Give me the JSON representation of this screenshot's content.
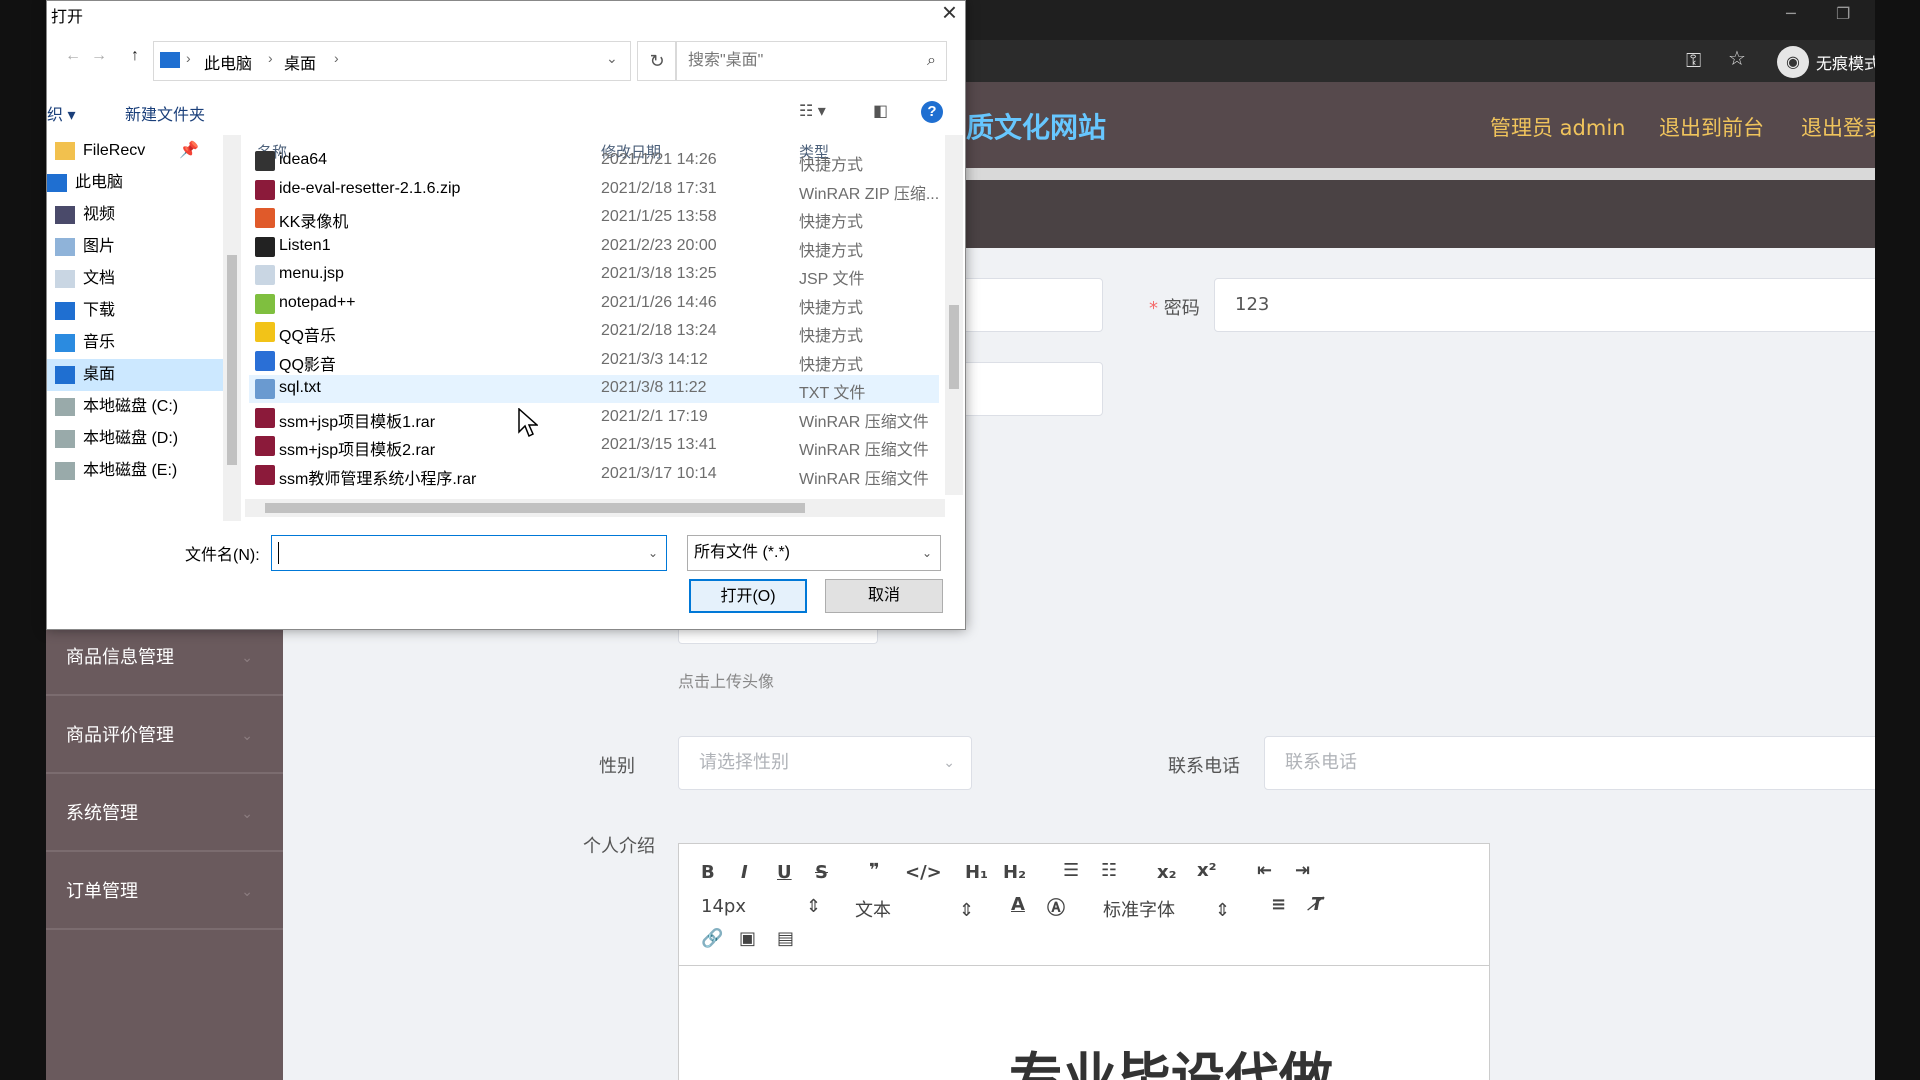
{
  "browser": {
    "profile_label": "无痕模式",
    "app": {
      "site_title": "质文化网站",
      "header_links": [
        "管理员 admin",
        "退出到前台",
        "退出登录"
      ]
    },
    "sidebar": {
      "items": [
        "商品信息管理",
        "商品评价管理",
        "系统管理",
        "订单管理"
      ]
    },
    "form": {
      "password_label": "密码",
      "password_value": "123",
      "upload_hint": "点击上传头像",
      "gender_label": "性别",
      "gender_placeholder": "请选择性别",
      "phone_label": "联系电话",
      "phone_placeholder": "联系电话",
      "intro_label": "个人介绍",
      "editor": {
        "font_size": "14px",
        "text_type": "文本",
        "font_family": "标准字体",
        "content_preview": "专业毕设代做"
      }
    }
  },
  "dialog": {
    "title": "打开",
    "address": [
      "此电脑",
      "桌面"
    ],
    "search_placeholder": "搜索\"桌面\"",
    "organize": "织",
    "new_folder": "新建文件夹",
    "nav": [
      {
        "label": "FileRecv",
        "icon": "folder-icon"
      },
      {
        "label": "此电脑",
        "icon": "computer-icon"
      },
      {
        "label": "视频",
        "icon": "video-icon"
      },
      {
        "label": "图片",
        "icon": "picture-icon"
      },
      {
        "label": "文档",
        "icon": "document-icon"
      },
      {
        "label": "下载",
        "icon": "download-icon"
      },
      {
        "label": "音乐",
        "icon": "music-icon"
      },
      {
        "label": "桌面",
        "icon": "desktop-icon",
        "selected": true
      },
      {
        "label": "本地磁盘 (C:)",
        "icon": "drive-icon"
      },
      {
        "label": "本地磁盘 (D:)",
        "icon": "drive-icon"
      },
      {
        "label": "本地磁盘 (E:)",
        "icon": "drive-icon"
      }
    ],
    "columns": [
      "名称",
      "修改日期",
      "类型"
    ],
    "files": [
      {
        "name": "idea64",
        "date": "2021/1/21 14:26",
        "type": "快捷方式",
        "icon": "app-shortcut-icon",
        "color": "#333333"
      },
      {
        "name": "ide-eval-resetter-2.1.6.zip",
        "date": "2021/2/18 17:31",
        "type": "WinRAR ZIP 压缩...",
        "icon": "winrar-icon",
        "color": "#8b1a3a"
      },
      {
        "name": "KK录像机",
        "date": "2021/1/25 13:58",
        "type": "快捷方式",
        "icon": "app-shortcut-icon",
        "color": "#e05a2a"
      },
      {
        "name": "Listen1",
        "date": "2021/2/23 20:00",
        "type": "快捷方式",
        "icon": "app-shortcut-icon",
        "color": "#222222"
      },
      {
        "name": "menu.jsp",
        "date": "2021/3/18 13:25",
        "type": "JSP 文件",
        "icon": "file-icon",
        "color": "#c9d6e3"
      },
      {
        "name": "notepad++",
        "date": "2021/1/26 14:46",
        "type": "快捷方式",
        "icon": "app-shortcut-icon",
        "color": "#7fbf3f"
      },
      {
        "name": "QQ音乐",
        "date": "2021/2/18 13:24",
        "type": "快捷方式",
        "icon": "app-shortcut-icon",
        "color": "#f2c318"
      },
      {
        "name": "QQ影音",
        "date": "2021/3/3 14:12",
        "type": "快捷方式",
        "icon": "app-shortcut-icon",
        "color": "#2a6fd6"
      },
      {
        "name": "sql.txt",
        "date": "2021/3/8 11:22",
        "type": "TXT 文件",
        "icon": "text-file-icon",
        "color": "#6a9ad0",
        "hover": true
      },
      {
        "name": "ssm+jsp项目模板1.rar",
        "date": "2021/2/1 17:19",
        "type": "WinRAR 压缩文件",
        "icon": "winrar-icon",
        "color": "#8b1a3a"
      },
      {
        "name": "ssm+jsp项目模板2.rar",
        "date": "2021/3/15 13:41",
        "type": "WinRAR 压缩文件",
        "icon": "winrar-icon",
        "color": "#8b1a3a"
      },
      {
        "name": "ssm教师管理系统小程序.rar",
        "date": "2021/3/17 10:14",
        "type": "WinRAR 压缩文件",
        "icon": "winrar-icon",
        "color": "#8b1a3a"
      }
    ],
    "filename_label": "文件名(N):",
    "filename_value": "",
    "filetype": "所有文件 (*.*)",
    "open_button": "打开(O)",
    "cancel_button": "取消"
  }
}
